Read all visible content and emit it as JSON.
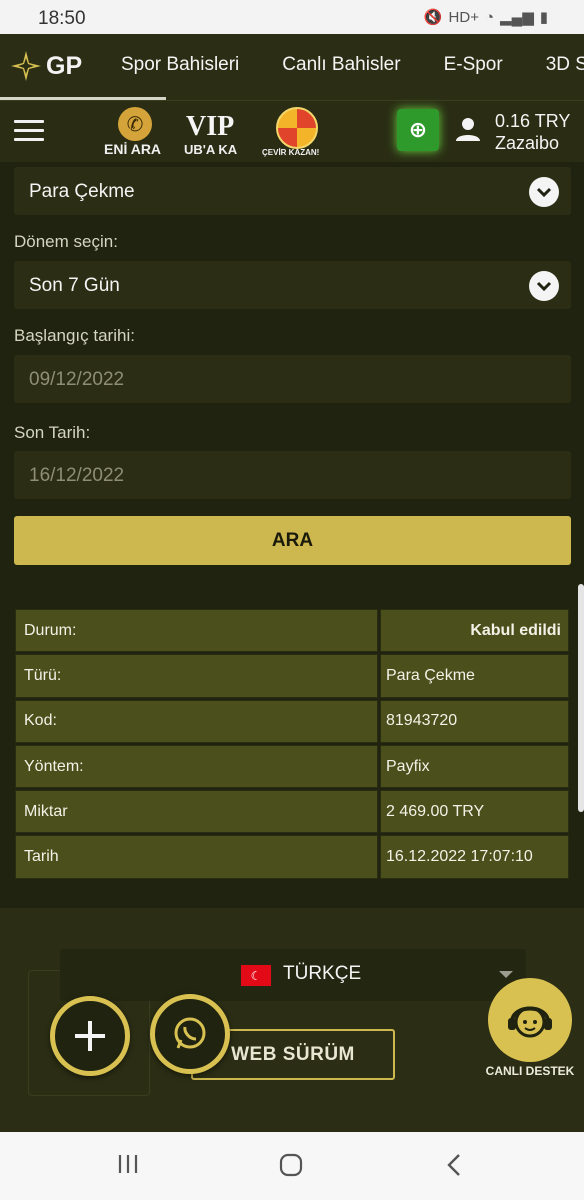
{
  "status_bar": {
    "time": "18:50",
    "network": "HD+"
  },
  "top_nav": {
    "logo_text": "GP",
    "tabs": [
      "Spor Bahisleri",
      "Canlı Bahisler",
      "E-Spor",
      "3D S"
    ]
  },
  "sub_header": {
    "promos": [
      "ENİ ARA",
      "UB'A KA",
      "ÇEVİR KAZAN!"
    ],
    "vip_text": "VIP",
    "balance": "0.16 TRY",
    "username": "Zazaibo"
  },
  "filters": {
    "type_select": "Para Çekme",
    "period_label": "Dönem seçin:",
    "period_select": "Son 7 Gün",
    "start_label": "Başlangıç tarihi:",
    "start_date": "09/12/2022",
    "end_label": "Son Tarih:",
    "end_date": "16/12/2022",
    "search_button": "ARA"
  },
  "details": {
    "rows": [
      {
        "key": "Durum:",
        "value": "Kabul edildi"
      },
      {
        "key": "Türü:",
        "value": "Para Çekme"
      },
      {
        "key": "Kod:",
        "value": "81943720"
      },
      {
        "key": "Yöntem:",
        "value": "Payfix"
      },
      {
        "key": "Miktar",
        "value": "2 469.00 TRY"
      },
      {
        "key": "Tarih",
        "value": "16.12.2022 17:07:10"
      }
    ]
  },
  "footer": {
    "language": "TÜRKÇE",
    "web_button": "WEB SÜRÜM",
    "support_label": "CANLI DESTEK"
  },
  "colors": {
    "background": "#1f230f",
    "header": "#2b2e14",
    "accent_gold": "#cdb74f",
    "table_cell": "#4a4f1c",
    "cash_green": "#2f9a2c"
  },
  "icons": [
    "gp-star-icon",
    "hamburger-icon",
    "phone-icon",
    "wheel-icon",
    "cash-icon",
    "user-icon",
    "chevron-down-icon",
    "flag-tr-icon",
    "plus-icon",
    "whatsapp-icon",
    "headset-icon",
    "back-icon",
    "home-icon",
    "recents-icon"
  ]
}
